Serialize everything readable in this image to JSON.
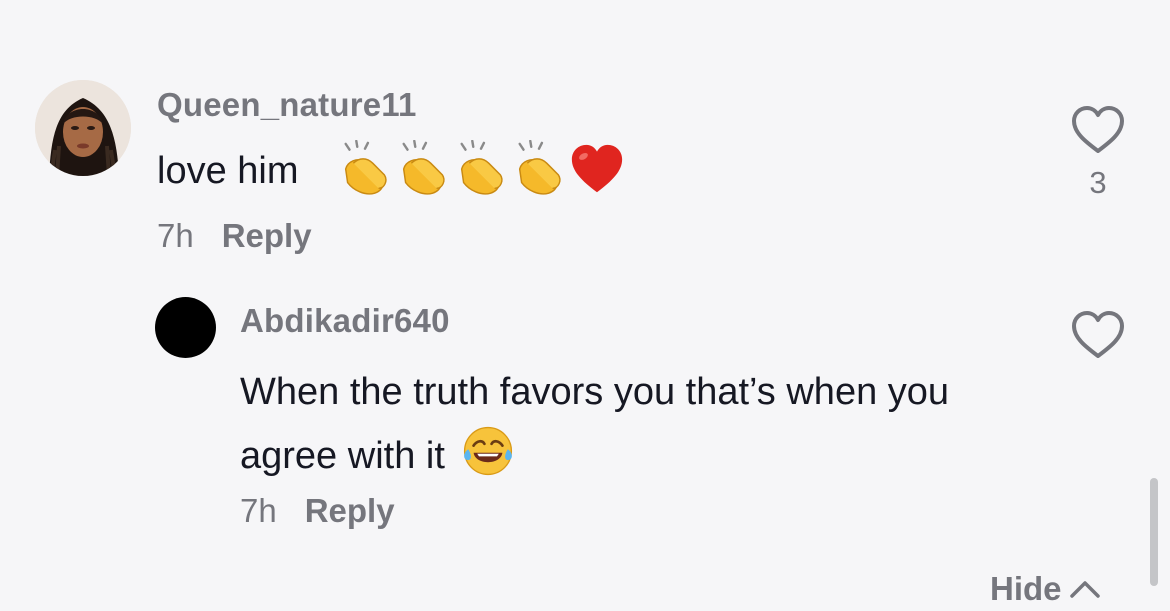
{
  "comments": [
    {
      "username": "Queen_nature11",
      "text": "love him",
      "emojis": [
        "clapping-hands",
        "clapping-hands",
        "clapping-hands",
        "clapping-hands",
        "red-heart"
      ],
      "time": "7h",
      "reply_label": "Reply",
      "like_count": "3",
      "avatar": "profile-photo"
    },
    {
      "username": "Abdikadir640",
      "text": "When the truth favors you that’s when you agree with it",
      "emojis": [
        "face-with-tears-of-joy"
      ],
      "time": "7h",
      "reply_label": "Reply",
      "avatar": "black-circle"
    }
  ],
  "hide_label": "Hide",
  "colors": {
    "background": "#f6f6f8",
    "primary_text": "#161823",
    "secondary_text": "#75767d",
    "heart_red": "#e0251f",
    "emoji_yellow": "#f5b92a"
  }
}
